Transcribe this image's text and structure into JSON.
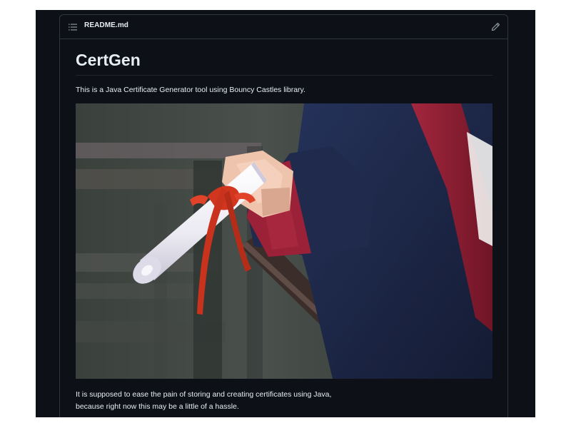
{
  "readme": {
    "filename": "README.md",
    "icons": {
      "outline": "list-unordered-icon",
      "edit": "pencil-icon"
    }
  },
  "content": {
    "title": "CertGen",
    "intro": "This is a Java Certificate Generator tool using Bouncy Castles library.",
    "image": {
      "subject": "hand-holding-rolled-diploma-tied-with-red-ribbon"
    },
    "description_line1": "It is supposed to ease the pain of storing and creating certificates using Java,",
    "description_line2": "because right now this may be a little of a hassle."
  },
  "colors": {
    "background": "#0d1117",
    "border": "#30363d",
    "text": "#e6edf3",
    "ribbon": "#d2361f",
    "gown_sleeve": "#1c2541",
    "gown_trim": "#8e1f34"
  }
}
